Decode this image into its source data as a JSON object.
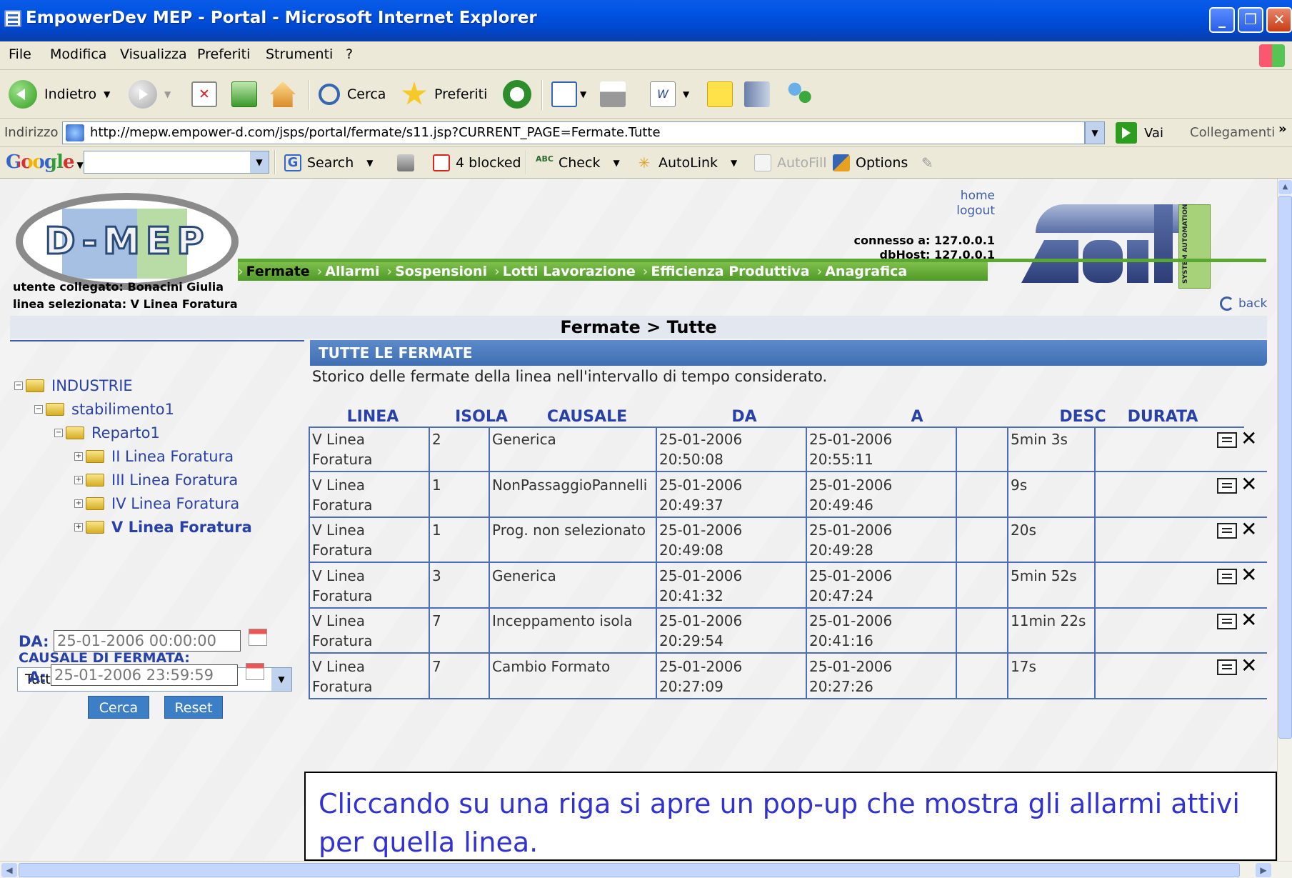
{
  "window": {
    "title": "EmpowerDev MEP - Portal - Microsoft Internet Explorer",
    "controls": [
      "_",
      "❐",
      "✕"
    ]
  },
  "menu": [
    "File",
    "Modifica",
    "Visualizza",
    "Preferiti",
    "Strumenti",
    "?"
  ],
  "toolbar": {
    "back_label": "Indietro",
    "search_label": "Cerca",
    "favorites_label": "Preferiti"
  },
  "address": {
    "label": "Indirizzo",
    "url": "http://mepw.empower-d.com/jsps/portal/fermate/s11.jsp?CURRENT_PAGE=Fermate.Tutte",
    "go_label": "Vai",
    "links_label": "Collegamenti",
    "overflow": "»"
  },
  "googlebar": {
    "logo": "Google",
    "search_label": "Search",
    "blocked_label": "4 blocked",
    "check_label": "Check",
    "autolink_label": "AutoLink",
    "autofill_label": "AutoFill",
    "options_label": "Options"
  },
  "header": {
    "logo_text": "D-MEP",
    "home_link": "home",
    "logout_link": "logout",
    "connesso": "connesso a: 127.0.0.1",
    "dbhost": "dbHost: 127.0.0.1",
    "asti_side_text": "SYSTEM AUTOMATION"
  },
  "nav": [
    "Fermate",
    "Allarmi",
    "Sospensioni",
    "Lotti Lavorazione",
    "Efficienza Produttiva",
    "Anagrafica"
  ],
  "user": {
    "utente": "utente collegato: Bonacini Giulia",
    "linea": "linea selezionata: V Linea Foratura",
    "back_label": "back"
  },
  "breadcrumb": "Fermate > Tutte",
  "tree": [
    {
      "label": "INDUSTRIE",
      "pm": "−"
    },
    {
      "label": "stabilimento1",
      "pm": "−"
    },
    {
      "label": "Reparto1",
      "pm": "−"
    },
    {
      "label": "II Linea Foratura",
      "pm": "+"
    },
    {
      "label": "III Linea Foratura",
      "pm": "+"
    },
    {
      "label": "IV Linea Foratura",
      "pm": "+"
    },
    {
      "label": "V Linea Foratura",
      "pm": "+"
    }
  ],
  "filter": {
    "causale_label": "CAUSALE DI FERMATA:",
    "causale_value": "Tutte",
    "da_label": "DA:",
    "da_value": "25-01-2006 00:00:00",
    "a_label": "A:",
    "a_value": "25-01-2006 23:59:59",
    "search_button": "Cerca",
    "reset_button": "Reset"
  },
  "main": {
    "section_title": "TUTTE LE FERMATE",
    "description": "Storico delle fermate della linea nell'intervallo di tempo considerato.",
    "columns": [
      "LINEA",
      "ISOLA",
      "CAUSALE",
      "DA",
      "A",
      "DESC",
      "DURATA"
    ],
    "rows": [
      {
        "linea": "V Linea Foratura",
        "isola": "2",
        "causale": "Generica",
        "da": "25-01-2006 20:50:08",
        "a": "25-01-2006 20:55:11",
        "desc": "",
        "durata": "5min 3s"
      },
      {
        "linea": "V Linea Foratura",
        "isola": "1",
        "causale": "NonPassaggioPannelli",
        "da": "25-01-2006 20:49:37",
        "a": "25-01-2006 20:49:46",
        "desc": "",
        "durata": "9s"
      },
      {
        "linea": "V Linea Foratura",
        "isola": "1",
        "causale": "Prog. non selezionato",
        "da": "25-01-2006 20:49:08",
        "a": "25-01-2006 20:49:28",
        "desc": "",
        "durata": "20s"
      },
      {
        "linea": "V Linea Foratura",
        "isola": "3",
        "causale": "Generica",
        "da": "25-01-2006 20:41:32",
        "a": "25-01-2006 20:47:24",
        "desc": "",
        "durata": "5min 52s"
      },
      {
        "linea": "V Linea Foratura",
        "isola": "7",
        "causale": "Inceppamento isola",
        "da": "25-01-2006 20:29:54",
        "a": "25-01-2006 20:41:16",
        "desc": "",
        "durata": "11min 22s"
      },
      {
        "linea": "V Linea Foratura",
        "isola": "7",
        "causale": "Cambio Formato",
        "da": "25-01-2006 20:27:09",
        "a": "25-01-2006 20:27:26",
        "desc": "",
        "durata": "17s"
      }
    ],
    "delete_glyph": "✕"
  },
  "callout": "Cliccando su una riga si apre un pop-up che mostra gli allarmi attivi per quella linea."
}
